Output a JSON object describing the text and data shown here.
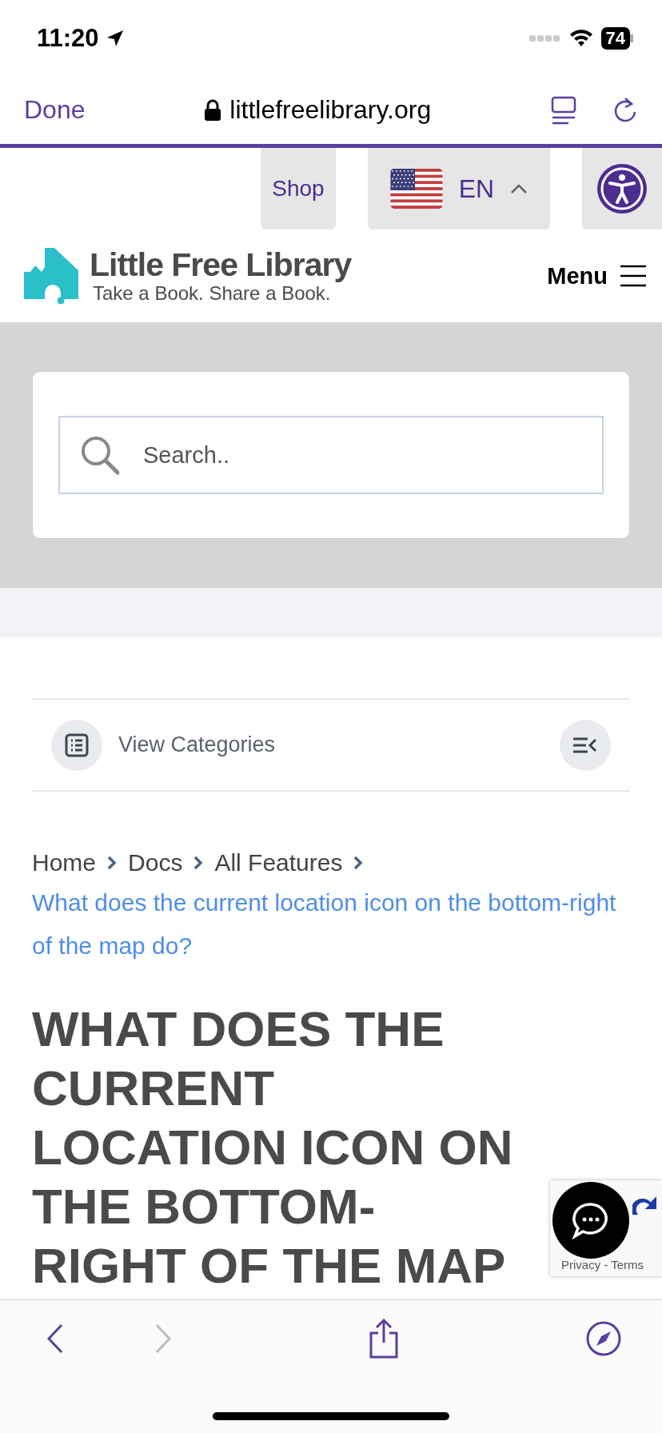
{
  "status_bar": {
    "time": "11:20",
    "battery": "74"
  },
  "browser": {
    "done": "Done",
    "url": "littlefreelibrary.org"
  },
  "top_links": {
    "shop": "Shop",
    "language": "EN"
  },
  "logo": {
    "name": "Little Free Library",
    "tagline": "Take a Book. Share a Book."
  },
  "menu": {
    "label": "Menu"
  },
  "search": {
    "placeholder": "Search.."
  },
  "categories": {
    "label": "View Categories"
  },
  "breadcrumb": {
    "items": [
      "Home",
      "Docs",
      "All Features"
    ],
    "current": "What does the current location icon on the bottom-right of the map do?"
  },
  "title_lines": [
    "WHAT DOES THE",
    "CURRENT",
    "LOCATION ICON ON",
    "THE BOTTOM-",
    "RIGHT OF THE MAP"
  ],
  "recaptcha": {
    "links": "Privacy - Terms"
  },
  "toolbar": {
    "back_disabled": false,
    "forward_disabled": true
  }
}
